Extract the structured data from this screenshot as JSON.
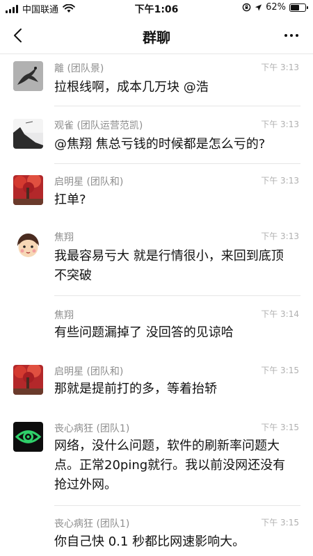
{
  "status_bar": {
    "carrier": "中国联通",
    "time": "下午1:06",
    "battery": "62%",
    "battery_level": 0.62,
    "icons": [
      "signal-icon",
      "wifi-icon",
      "rotation-lock-icon",
      "location-icon",
      "battery-icon"
    ]
  },
  "nav": {
    "title": "群聊",
    "back_icon": "chevron-left-icon",
    "more_icon": "more-dots-icon"
  },
  "messages": [
    {
      "sender": "離 (团队景)",
      "time": "下午 3:13",
      "text": "拉根线啊，成本几万块 @浩",
      "avatar": "dragon-avatar"
    },
    {
      "sender": "观雀 (团队运营范凯)",
      "time": "下午 3:13",
      "text": "@焦翔 焦总亏钱的时候都是怎么亏的?",
      "avatar": "landscape-avatar"
    },
    {
      "sender": "启明星 (团队和)",
      "time": "下午 3:13",
      "text": "扛单?",
      "avatar": "red-tree-avatar"
    },
    {
      "sender": "焦翔",
      "time": "下午 3:13",
      "text": "我最容易亏大  就是行情很小，来回到底顶 不突破",
      "avatar": "cartoon-face-avatar"
    },
    {
      "sender": "焦翔",
      "time": "下午 3:14",
      "text": "有些问题漏掉了  没回答的见谅哈",
      "avatar": ""
    },
    {
      "sender": "启明星 (团队和)",
      "time": "下午 3:15",
      "text": "那就是提前打的多，等着抬轿",
      "avatar": "red-tree-avatar"
    },
    {
      "sender": "丧心病狂 (团队1)",
      "time": "下午 3:15",
      "text": "网络，没什么问题，软件的刷新率问题大点。正常20ping就行。我以前没网还没有抢过外网。",
      "avatar": "green-eye-avatar"
    },
    {
      "sender": "丧心病狂 (团队1)",
      "time": "下午 3:15",
      "text": "你自己快 0.1 秒都比网速影响大。",
      "avatar": ""
    }
  ]
}
